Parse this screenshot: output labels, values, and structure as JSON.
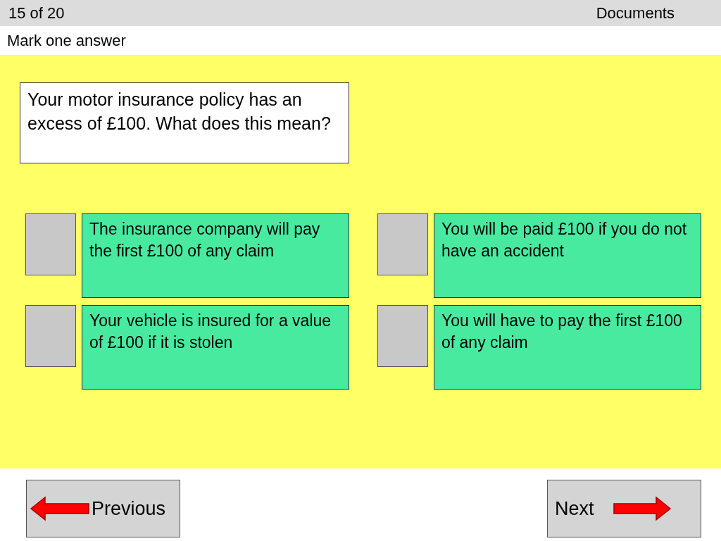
{
  "header": {
    "counter": "15 of 20",
    "category": "Documents"
  },
  "instruction": "Mark one answer",
  "question": "Your motor insurance policy has an excess of £100.  What does this mean?",
  "answers": [
    {
      "text": "The insurance company will pay the first £100 of any claim",
      "selected": false
    },
    {
      "text": "You will be paid £100 if you do not have an accident",
      "selected": false
    },
    {
      "text": "Your vehicle is insured for a value of £100 if it is stolen",
      "selected": false
    },
    {
      "text": "You will have to pay the first £100 of any claim",
      "selected": false
    }
  ],
  "navigation": {
    "previous": "Previous",
    "next": "Next"
  }
}
